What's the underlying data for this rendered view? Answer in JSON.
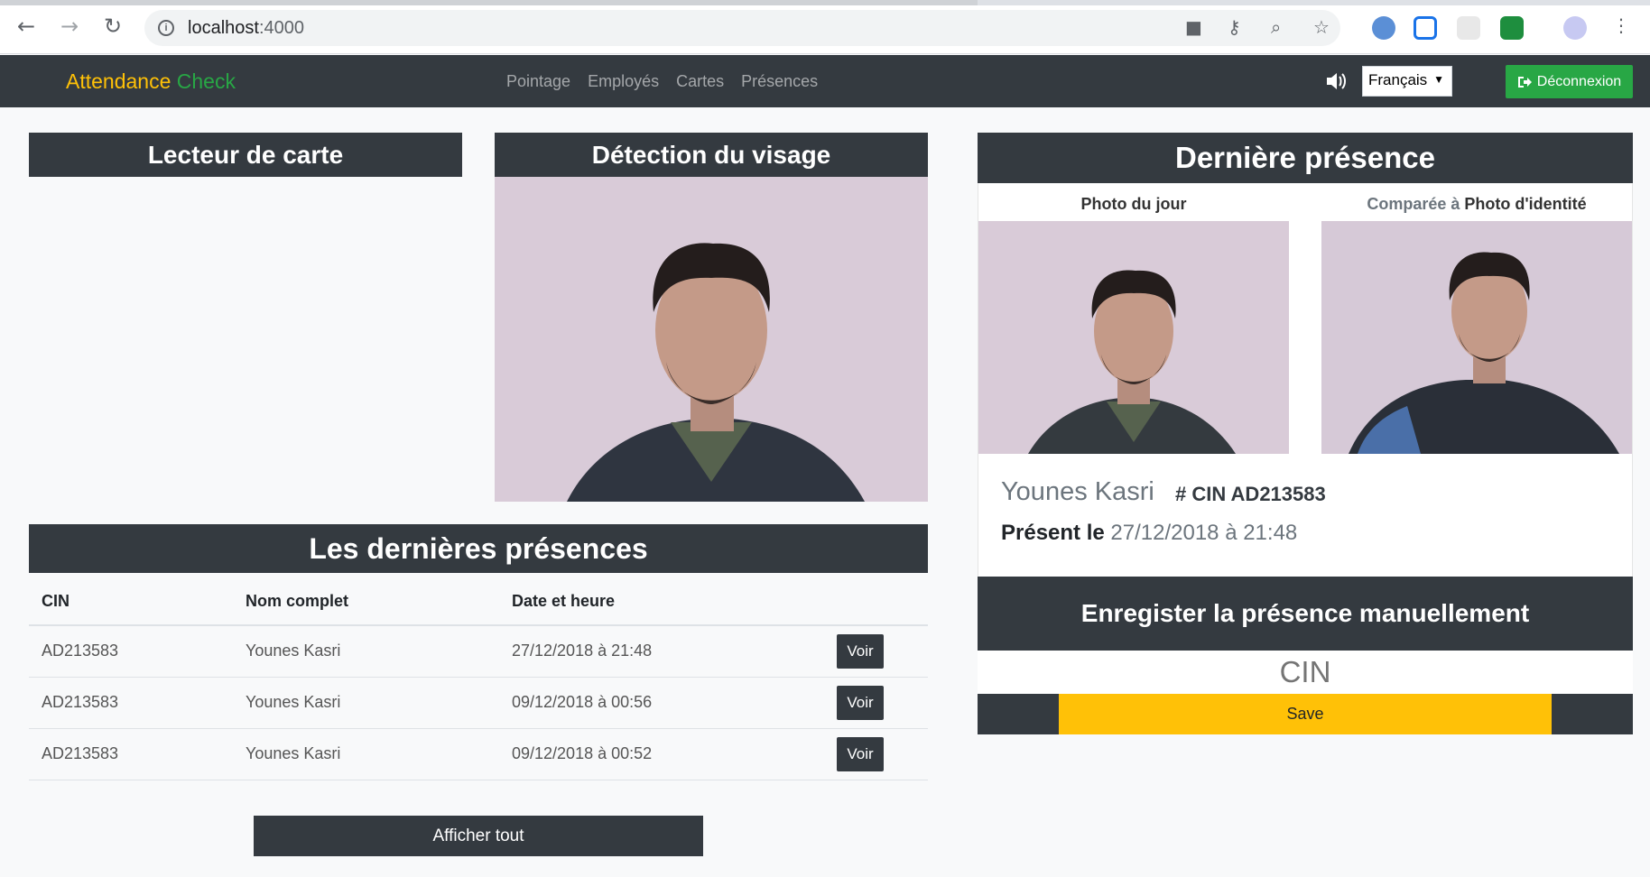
{
  "browser": {
    "url_host": "localhost",
    "url_port": ":4000"
  },
  "navbar": {
    "brand_part1": "Attendance",
    "brand_part2": "Check",
    "links": [
      "Pointage",
      "Employés",
      "Cartes",
      "Présences"
    ],
    "language": "Français",
    "logout_label": "Déconnexion"
  },
  "card_reader": {
    "title": "Lecteur de carte"
  },
  "face_detection": {
    "title": "Détection du visage"
  },
  "recent": {
    "title": "Les dernières présences",
    "columns": [
      "CIN",
      "Nom complet",
      "Date et heure"
    ],
    "rows": [
      {
        "cin": "AD213583",
        "name": "Younes Kasri",
        "datetime": "27/12/2018 à 21:48",
        "action": "Voir"
      },
      {
        "cin": "AD213583",
        "name": "Younes Kasri",
        "datetime": "09/12/2018 à 00:56",
        "action": "Voir"
      },
      {
        "cin": "AD213583",
        "name": "Younes Kasri",
        "datetime": "09/12/2018 à 00:52",
        "action": "Voir"
      }
    ],
    "show_all_label": "Afficher tout"
  },
  "last_presence": {
    "title": "Dernière présence",
    "photo_today_label": "Photo du jour",
    "compared_prefix": "Comparée à",
    "id_photo_label": "Photo d'identité",
    "name": "Younes Kasri",
    "cin_prefix": "# CIN",
    "cin_value": "AD213583",
    "present_label": "Présent le",
    "present_value": "27/12/2018 à 21:48"
  },
  "manual": {
    "title": "Enregister la présence manuellement",
    "cin_placeholder": "CIN",
    "save_label": "Save"
  },
  "colors": {
    "dark": "#343a40",
    "brand_yellow": "#ffc107",
    "brand_green": "#28a745"
  }
}
